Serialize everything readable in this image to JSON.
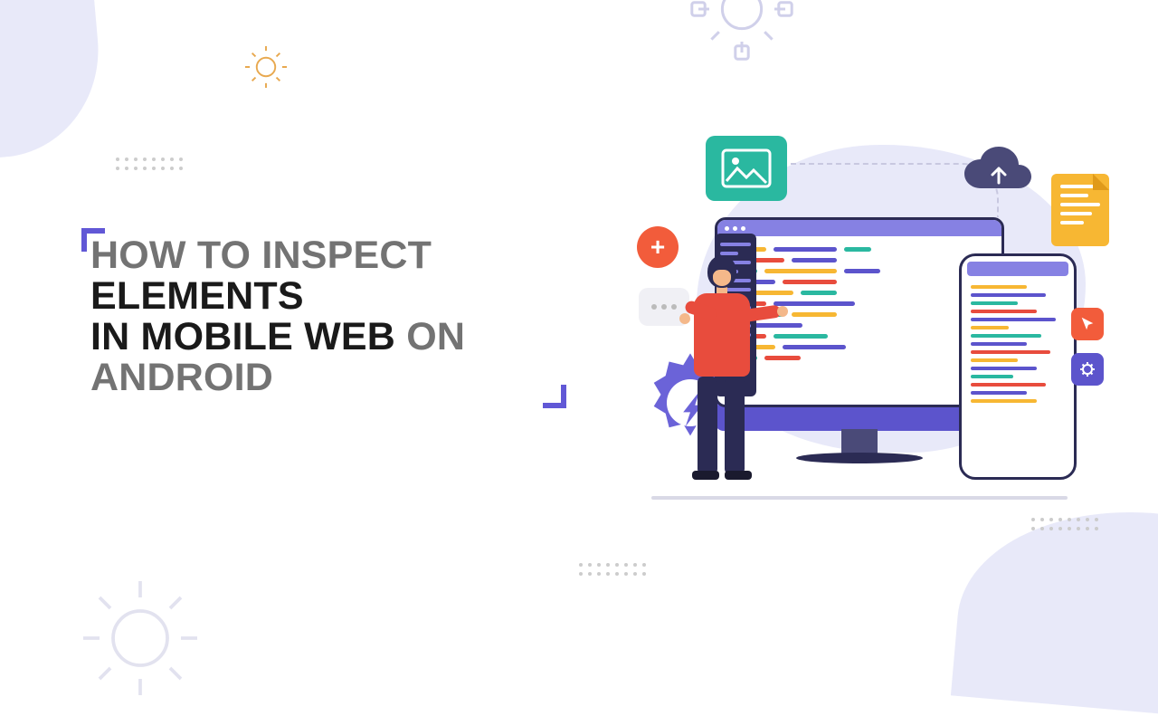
{
  "title": {
    "line1_dim": "HOW TO INSPECT ",
    "line1_strong": "ELEMENTS",
    "line2_pre": "IN ",
    "line2_strong": "MOBILE WEB ",
    "line2_dim": "ON ANDROID"
  },
  "colors": {
    "accent": "#6158d6",
    "light_accent": "#e8e9f9",
    "orange": "#f25c3b",
    "teal": "#2ab8a0",
    "yellow": "#f7b733",
    "dark": "#2b2b54"
  }
}
